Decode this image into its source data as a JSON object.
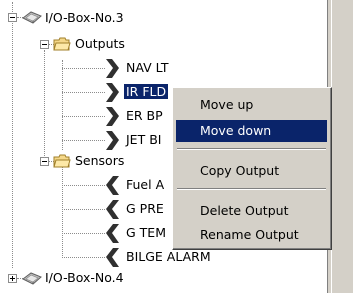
{
  "tree": {
    "box3_label": "I/O-Box-No.3",
    "outputs_label": "Outputs",
    "outputs": [
      "NAV LT",
      "IR FLD",
      "ER BP",
      "JET BI"
    ],
    "sensors_label": "Sensors",
    "sensors": [
      "Fuel A",
      "G PRE",
      "G TEM",
      "BILGE ALARM"
    ],
    "box4_label": "I/O-Box-No.4"
  },
  "menu": {
    "items": [
      "Move up",
      "Move down",
      "Copy Output",
      "Delete Output",
      "Rename Output"
    ],
    "highlighted": "Move down"
  },
  "colors": {
    "selection": "#0a246a",
    "face": "#d4d0c8"
  }
}
